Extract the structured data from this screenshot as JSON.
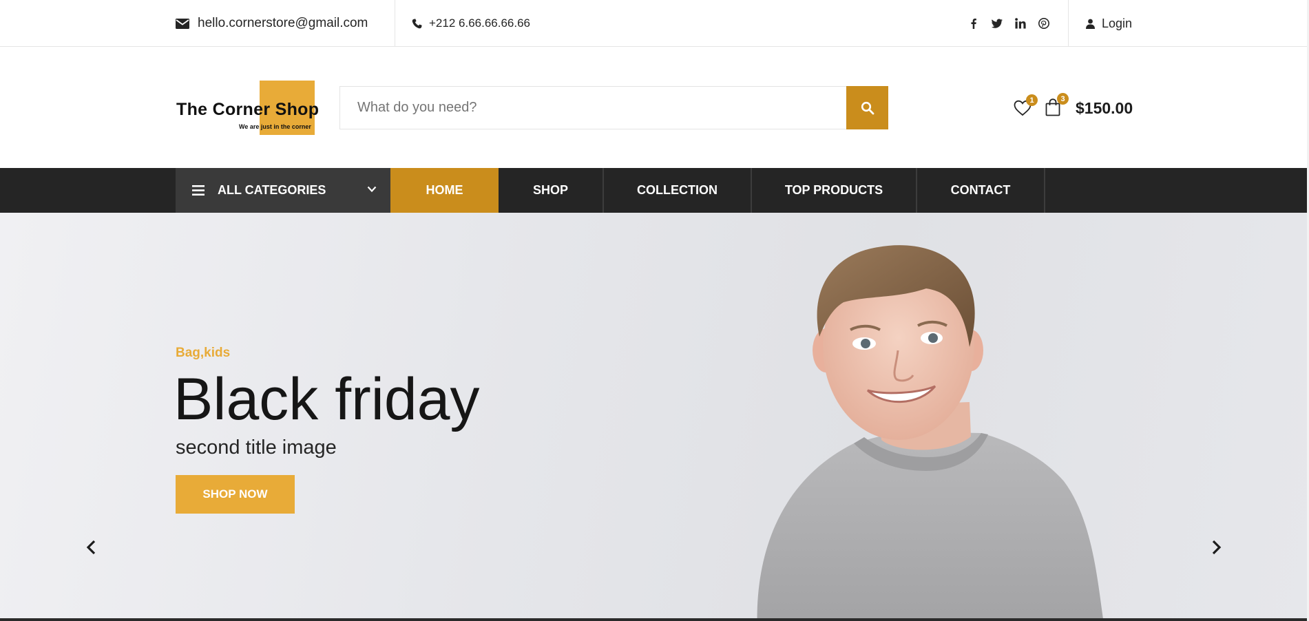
{
  "topbar": {
    "email": "hello.cornerstore@gmail.com",
    "phone": "+212 6.66.66.66.66",
    "social": [
      "facebook-icon",
      "twitter-icon",
      "linkedin-icon",
      "pinterest-icon"
    ],
    "login_label": "Login"
  },
  "header": {
    "logo_title": "The  Corner Shop",
    "logo_tagline": "We are just in the corner",
    "search_placeholder": "What do you need?",
    "wishlist_count": "1",
    "cart_count": "3",
    "cart_total": "$150.00"
  },
  "nav": {
    "all_categories": "ALL CATEGORIES",
    "items": [
      {
        "label": "HOME",
        "active": true
      },
      {
        "label": "SHOP",
        "active": false
      },
      {
        "label": "COLLECTION",
        "active": false
      },
      {
        "label": "TOP PRODUCTS",
        "active": false
      },
      {
        "label": "CONTACT",
        "active": false
      }
    ]
  },
  "hero": {
    "category": "Bag,kids",
    "title": "Black friday",
    "subtitle": "second title image",
    "button_label": "SHOP NOW"
  },
  "colors": {
    "accent": "#ca8d1c",
    "accent_light": "#e8ab38",
    "nav_bg": "#252525",
    "allcat_bg": "#3a3a3a"
  }
}
